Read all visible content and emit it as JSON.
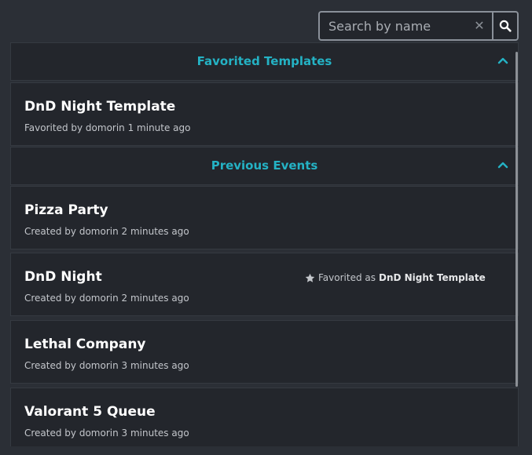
{
  "search": {
    "placeholder": "Search by name",
    "value": "",
    "clear_icon": "close-icon",
    "search_icon": "search-icon"
  },
  "sections": [
    {
      "title": "Favorited Templates",
      "icon": "chevron-up-icon",
      "items": [
        {
          "title": "DnD Night Template",
          "subtitle": "Favorited by domorin 1 minute ago"
        }
      ]
    },
    {
      "title": "Previous Events",
      "icon": "chevron-up-icon",
      "items": [
        {
          "title": "Pizza Party",
          "subtitle": "Created by domorin 2 minutes ago"
        },
        {
          "title": "DnD Night",
          "subtitle": "Created by domorin 2 minutes ago",
          "favorite_note": {
            "prefix": "Favorited as",
            "template": "DnD Night Template",
            "icon": "star-icon"
          }
        },
        {
          "title": "Lethal Company",
          "subtitle": "Created by domorin 3 minutes ago"
        },
        {
          "title": "Valorant 5 Queue",
          "subtitle": "Created by domorin 3 minutes ago"
        }
      ]
    }
  ],
  "colors": {
    "background": "#2b2f36",
    "card": "#23262c",
    "accent": "#24b2c4",
    "text": "#ffffff",
    "muted": "#c3c6cb"
  }
}
